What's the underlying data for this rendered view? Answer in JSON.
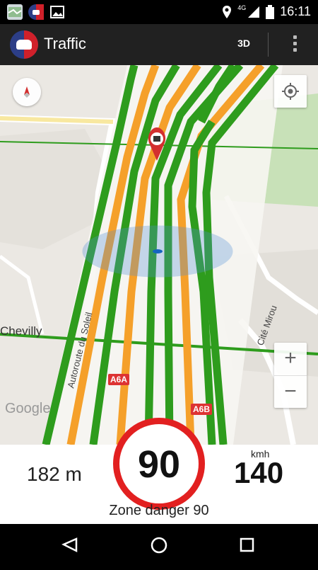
{
  "status_bar": {
    "time": "16:11",
    "network": "4G",
    "icons": [
      "map-notification-icon",
      "app-notification-icon",
      "image-notification-icon",
      "location-icon",
      "signal-icon",
      "battery-icon"
    ]
  },
  "app_bar": {
    "title": "Traffic",
    "mode_button": "3D"
  },
  "map": {
    "labels": {
      "town": "Chevilly",
      "road_left": "Autoroute du Soleil",
      "road_right": "Cité Mirou"
    },
    "road_badges": [
      "A6A",
      "A6B"
    ],
    "attribution": "Google",
    "zoom_in": "+",
    "zoom_out": "−"
  },
  "info": {
    "distance": "182 m",
    "speed_limit": "90",
    "speed_unit": "kmh",
    "current_speed": "140",
    "zone_text": "Zone danger 90"
  },
  "colors": {
    "status_bar": "#000000",
    "app_bar": "#212121",
    "map_bg": "#ebe8e3",
    "road_green": "#2e9c1d",
    "road_orange": "#f5a02a",
    "speed_ring": "#e22020",
    "navbar": "#000000"
  }
}
